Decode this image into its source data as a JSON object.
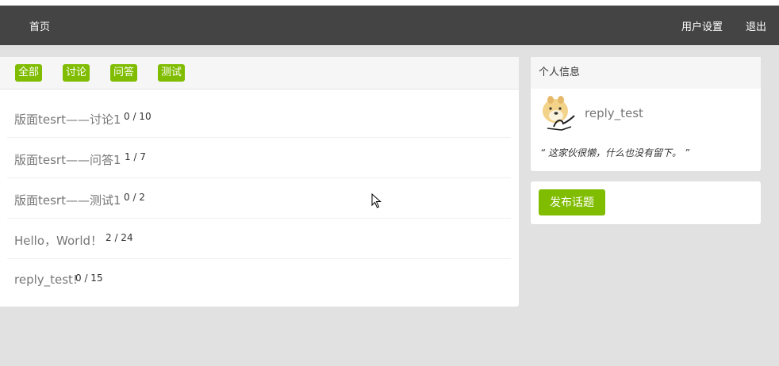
{
  "nav": {
    "home": "首页",
    "settings": "用户设置",
    "logout": "退出"
  },
  "tabs": [
    "全部",
    "讨论",
    "问答",
    "测试"
  ],
  "topics": [
    {
      "title": "版面tesrt——讨论1",
      "count": "0 / 10"
    },
    {
      "title": "版面tesrt——问答1",
      "count": "1 / 7"
    },
    {
      "title": "版面tesrt——测试1",
      "count": "0 / 2"
    },
    {
      "title": "Hello，World！",
      "count": "2 / 24"
    },
    {
      "title": "reply_test!",
      "count": "0 / 15"
    }
  ],
  "profile": {
    "header": "个人信息",
    "username": "reply_test",
    "signature": "“ 这家伙很懒，什么也没有留下。 ”"
  },
  "post": {
    "label": "发布话题"
  },
  "colors": {
    "navbar": "#444444",
    "accent": "#80bd01",
    "background": "#e1e1e1"
  }
}
